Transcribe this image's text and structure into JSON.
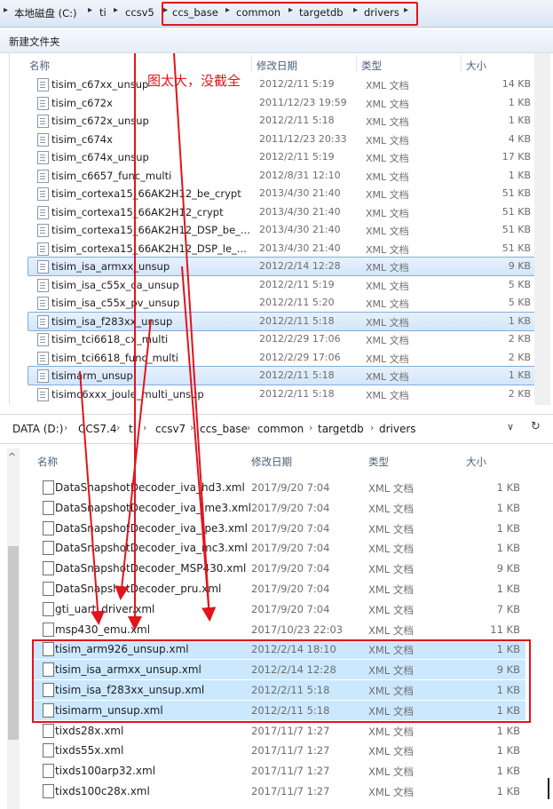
{
  "explorer1": {
    "breadcrumb": [
      "本地磁盘 (C:)",
      "ti",
      "ccsv5",
      "ccs_base",
      "common",
      "targetdb",
      "drivers"
    ],
    "toolbar": {
      "new_folder": "新建文件夹"
    },
    "columns": {
      "name": "名称",
      "date": "修改日期",
      "type": "类型",
      "size": "大小"
    },
    "note": "图太大，没截全",
    "files": [
      {
        "name": "tisim_c67xx_unsup",
        "date": "2012/2/11 5:19",
        "type": "XML 文档",
        "size": "14 KB",
        "selected": false
      },
      {
        "name": "tisim_c672x",
        "date": "2011/12/23 19:59",
        "type": "XML 文档",
        "size": "1 KB",
        "selected": false
      },
      {
        "name": "tisim_c672x_unsup",
        "date": "2012/2/11 5:18",
        "type": "XML 文档",
        "size": "1 KB",
        "selected": false
      },
      {
        "name": "tisim_c674x",
        "date": "2011/12/23 20:33",
        "type": "XML 文档",
        "size": "4 KB",
        "selected": false
      },
      {
        "name": "tisim_c674x_unsup",
        "date": "2012/2/11 5:19",
        "type": "XML 文档",
        "size": "17 KB",
        "selected": false
      },
      {
        "name": "tisim_c6657_func_multi",
        "date": "2012/8/31 12:10",
        "type": "XML 文档",
        "size": "1 KB",
        "selected": false
      },
      {
        "name": "tisim_cortexa15_66AK2H12_be_crypt",
        "date": "2013/4/30 21:40",
        "type": "XML 文档",
        "size": "51 KB",
        "selected": false
      },
      {
        "name": "tisim_cortexa15_66AK2H12_crypt",
        "date": "2013/4/30 21:40",
        "type": "XML 文档",
        "size": "51 KB",
        "selected": false
      },
      {
        "name": "tisim_cortexa15_66AK2H12_DSP_be_...",
        "date": "2013/4/30 21:40",
        "type": "XML 文档",
        "size": "51 KB",
        "selected": false
      },
      {
        "name": "tisim_cortexa15_66AK2H12_DSP_le_...",
        "date": "2013/4/30 21:40",
        "type": "XML 文档",
        "size": "51 KB",
        "selected": false
      },
      {
        "name": "tisim_isa_armxx_unsup",
        "date": "2012/2/14 12:28",
        "type": "XML 文档",
        "size": "9 KB",
        "selected": true
      },
      {
        "name": "tisim_isa_c55x_ca_unsup",
        "date": "2012/2/11 5:19",
        "type": "XML 文档",
        "size": "5 KB",
        "selected": false
      },
      {
        "name": "tisim_isa_c55x_pv_unsup",
        "date": "2012/2/11 5:20",
        "type": "XML 文档",
        "size": "5 KB",
        "selected": false
      },
      {
        "name": "tisim_isa_f283xx_unsup",
        "date": "2012/2/11 5:18",
        "type": "XML 文档",
        "size": "1 KB",
        "selected": true
      },
      {
        "name": "tisim_tci6618_cx_multi",
        "date": "2012/2/29 17:06",
        "type": "XML 文档",
        "size": "2 KB",
        "selected": false
      },
      {
        "name": "tisim_tci6618_func_multi",
        "date": "2012/2/29 17:06",
        "type": "XML 文档",
        "size": "2 KB",
        "selected": false
      },
      {
        "name": "tisimarm_unsup",
        "date": "2012/2/11 5:18",
        "type": "XML 文档",
        "size": "1 KB",
        "selected": true
      },
      {
        "name": "tisimc6xxx_joule_multi_unsup",
        "date": "2012/2/11 5:18",
        "type": "XML 文档",
        "size": "2 KB",
        "selected": false
      }
    ]
  },
  "explorer2": {
    "breadcrumb": [
      "DATA (D:)",
      "CCS7.4",
      "ti",
      "ccsv7",
      "ccs_base",
      "common",
      "targetdb",
      "drivers"
    ],
    "controls": {
      "dropdown": "∨",
      "refresh": "↻"
    },
    "columns": {
      "name": "名称",
      "date": "修改日期",
      "type": "类型",
      "size": "大小"
    },
    "files": [
      {
        "name": "DataSnapshotDecoder_iva_hd3.xml",
        "date": "2017/9/20 7:04",
        "type": "XML 文档",
        "size": "1 KB",
        "selected": false
      },
      {
        "name": "DataSnapshotDecoder_iva_ime3.xml",
        "date": "2017/9/20 7:04",
        "type": "XML 文档",
        "size": "1 KB",
        "selected": false
      },
      {
        "name": "DataSnapshotDecoder_iva_ipe3.xml",
        "date": "2017/9/20 7:04",
        "type": "XML 文档",
        "size": "1 KB",
        "selected": false
      },
      {
        "name": "DataSnapshotDecoder_iva_mc3.xml",
        "date": "2017/9/20 7:04",
        "type": "XML 文档",
        "size": "1 KB",
        "selected": false
      },
      {
        "name": "DataSnapshotDecoder_MSP430.xml",
        "date": "2017/9/20 7:04",
        "type": "XML 文档",
        "size": "9 KB",
        "selected": false
      },
      {
        "name": "DataSnapshotDecoder_pru.xml",
        "date": "2017/9/20 7:04",
        "type": "XML 文档",
        "size": "1 KB",
        "selected": false
      },
      {
        "name": "gti_uart_driver.xml",
        "date": "2017/9/20 7:04",
        "type": "XML 文档",
        "size": "7 KB",
        "selected": false
      },
      {
        "name": "msp430_emu.xml",
        "date": "2017/10/23 22:03",
        "type": "XML 文档",
        "size": "11 KB",
        "selected": false
      },
      {
        "name": "tisim_arm926_unsup.xml",
        "date": "2012/2/14 18:10",
        "type": "XML 文档",
        "size": "1 KB",
        "selected": true
      },
      {
        "name": "tisim_isa_armxx_unsup.xml",
        "date": "2012/2/14 12:28",
        "type": "XML 文档",
        "size": "9 KB",
        "selected": true
      },
      {
        "name": "tisim_isa_f283xx_unsup.xml",
        "date": "2012/2/11 5:18",
        "type": "XML 文档",
        "size": "1 KB",
        "selected": true
      },
      {
        "name": "tisimarm_unsup.xml",
        "date": "2012/2/11 5:18",
        "type": "XML 文档",
        "size": "1 KB",
        "selected": true
      },
      {
        "name": "tixds28x.xml",
        "date": "2017/11/7 1:27",
        "type": "XML 文档",
        "size": "1 KB",
        "selected": false
      },
      {
        "name": "tixds55x.xml",
        "date": "2017/11/7 1:27",
        "type": "XML 文档",
        "size": "1 KB",
        "selected": false
      },
      {
        "name": "tixds100arp32.xml",
        "date": "2017/11/7 1:27",
        "type": "XML 文档",
        "size": "1 KB",
        "selected": false
      },
      {
        "name": "tixds100c28x.xml",
        "date": "2017/11/7 1:27",
        "type": "XML 文档",
        "size": "1 KB",
        "selected": false
      }
    ]
  },
  "annotation_colors": {
    "red": "#e2141c",
    "selection_blue": "#cce8ff"
  }
}
